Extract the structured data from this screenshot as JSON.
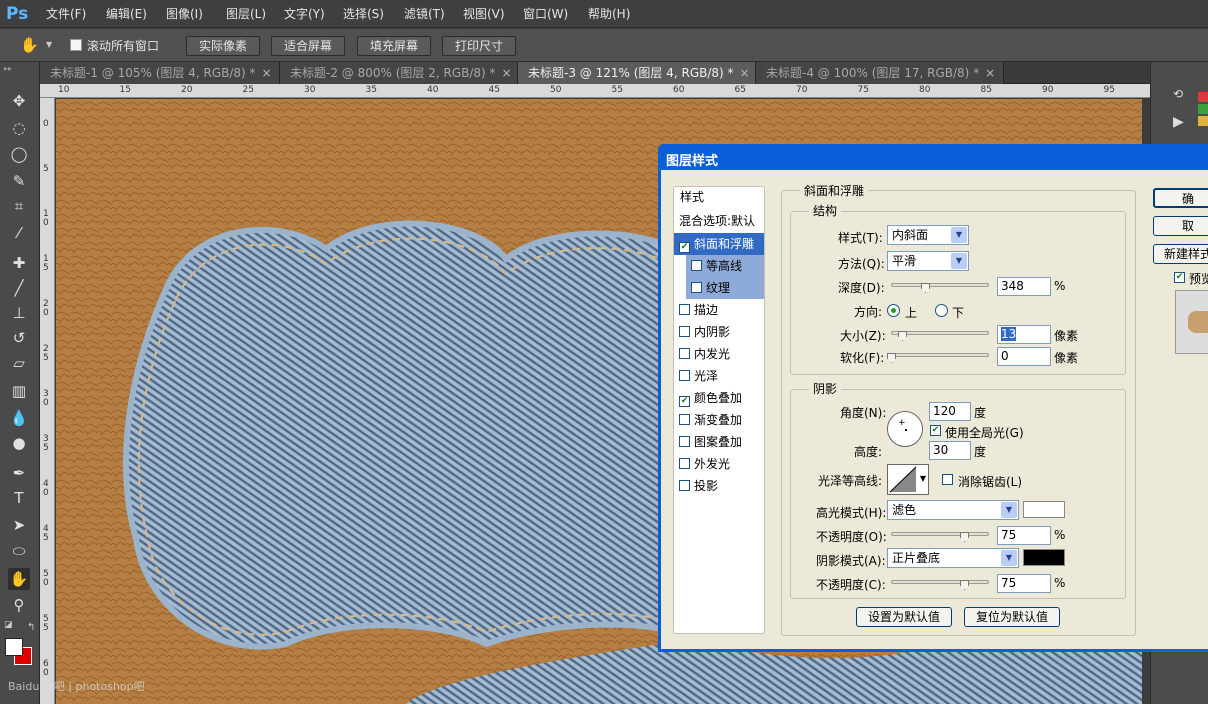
{
  "app": {
    "logo": "Ps"
  },
  "menubar": [
    "文件(F)",
    "编辑(E)",
    "图像(I)",
    "图层(L)",
    "文字(Y)",
    "选择(S)",
    "滤镜(T)",
    "视图(V)",
    "窗口(W)",
    "帮助(H)"
  ],
  "options": {
    "tool_icon": "hand-icon",
    "scroll_all_label": "滚动所有窗口",
    "buttons": [
      "实际像素",
      "适合屏幕",
      "填充屏幕",
      "打印尺寸"
    ]
  },
  "tabs": [
    "未标题-1 @ 105% (图层 4, RGB/8) *",
    "未标题-2 @ 800% (图层 2, RGB/8) *",
    "未标题-3 @ 121% (图层 4, RGB/8) *",
    "未标题-4 @ 100% (图层 17, RGB/8) *"
  ],
  "tab_close": "×",
  "ruler_h": [
    "10",
    "15",
    "20",
    "25",
    "30",
    "35",
    "40",
    "45",
    "50",
    "55",
    "60",
    "65",
    "70",
    "75",
    "80",
    "85",
    "90",
    "95"
  ],
  "ruler_v": [
    "0",
    "5",
    "1 0",
    "1 5",
    "2 0",
    "2 5",
    "3 0",
    "3 5",
    "4 0",
    "4 5",
    "5 0",
    "5 5",
    "6 0"
  ],
  "dialog": {
    "title": "图层样式",
    "styles_header": "样式",
    "blend_options": "混合选项:默认",
    "styles": [
      {
        "label": "斜面和浮雕",
        "checked": true,
        "selected": true
      },
      {
        "label": "等高线",
        "checked": false,
        "sub": true
      },
      {
        "label": "纹理",
        "checked": false,
        "sub": true
      },
      {
        "label": "描边",
        "checked": false
      },
      {
        "label": "内阴影",
        "checked": false
      },
      {
        "label": "内发光",
        "checked": false
      },
      {
        "label": "光泽",
        "checked": false
      },
      {
        "label": "颜色叠加",
        "checked": true
      },
      {
        "label": "渐变叠加",
        "checked": false
      },
      {
        "label": "图案叠加",
        "checked": false
      },
      {
        "label": "外发光",
        "checked": false
      },
      {
        "label": "投影",
        "checked": false
      }
    ],
    "section_title": "斜面和浮雕",
    "structure": {
      "title": "结构",
      "style_label": "样式(T):",
      "style_value": "内斜面",
      "technique_label": "方法(Q):",
      "technique_value": "平滑",
      "depth_label": "深度(D):",
      "depth_value": "348",
      "depth_unit": "%",
      "direction_label": "方向:",
      "dir_up": "上",
      "dir_down": "下",
      "size_label": "大小(Z):",
      "size_value": "13",
      "size_unit": "像素",
      "soften_label": "软化(F):",
      "soften_value": "0",
      "soften_unit": "像素"
    },
    "shading": {
      "title": "阴影",
      "angle_label": "角度(N):",
      "angle_value": "120",
      "angle_unit": "度",
      "global_light_label": "使用全局光(G)",
      "altitude_label": "高度:",
      "altitude_value": "30",
      "altitude_unit": "度",
      "gloss_label": "光泽等高线:",
      "antialias_label": "消除锯齿(L)",
      "highlight_label": "高光模式(H):",
      "highlight_value": "滤色",
      "highlight_color": "#ffffff",
      "h_opacity_label": "不透明度(O):",
      "h_opacity_value": "75",
      "h_opacity_unit": "%",
      "shadow_label": "阴影模式(A):",
      "shadow_value": "正片叠底",
      "shadow_color": "#000000",
      "s_opacity_label": "不透明度(C):",
      "s_opacity_value": "75",
      "s_opacity_unit": "%"
    },
    "btn_set_default": "设置为默认值",
    "btn_reset_default": "复位为默认值",
    "btn_ok": "确",
    "btn_cancel": "取",
    "btn_new_style": "新建样式",
    "preview_label": "预览"
  },
  "watermark": "Baidu 贴吧 | photoshop吧"
}
